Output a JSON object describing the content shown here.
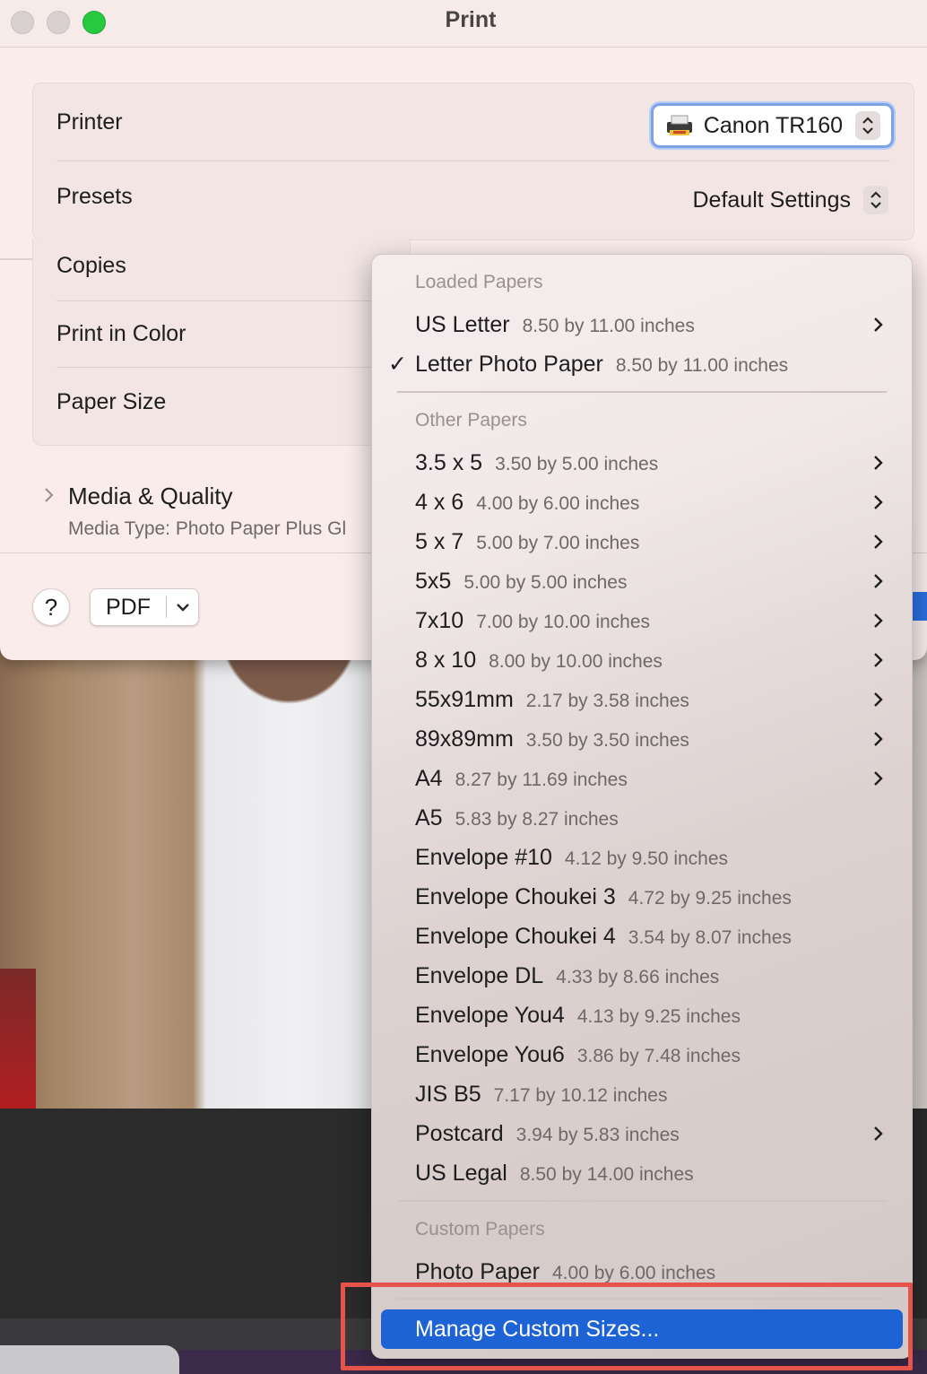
{
  "window": {
    "title": "Print"
  },
  "printer": {
    "label": "Printer",
    "value": "Canon TR160"
  },
  "presets": {
    "label": "Presets",
    "value": "Default Settings"
  },
  "settings": {
    "copies_label": "Copies",
    "color_label": "Print in Color",
    "paper_size_label": "Paper Size"
  },
  "media_quality": {
    "title": "Media & Quality",
    "subtitle": "Media Type: Photo Paper Plus Gl"
  },
  "footer": {
    "help_label": "?",
    "pdf_label": "PDF"
  },
  "menu": {
    "loaded_header": "Loaded Papers",
    "loaded": [
      {
        "name": "US Letter",
        "desc": "8.50 by 11.00 inches"
      },
      {
        "name": "Letter Photo Paper",
        "desc": "8.50 by 11.00 inches"
      }
    ],
    "other_header": "Other Papers",
    "other": [
      {
        "name": "3.5 x 5",
        "desc": "3.50 by 5.00 inches"
      },
      {
        "name": "4 x 6",
        "desc": "4.00 by 6.00 inches"
      },
      {
        "name": "5 x 7",
        "desc": "5.00 by 7.00 inches"
      },
      {
        "name": "5x5",
        "desc": "5.00 by 5.00 inches"
      },
      {
        "name": "7x10",
        "desc": "7.00 by 10.00 inches"
      },
      {
        "name": "8 x 10",
        "desc": "8.00 by 10.00 inches"
      },
      {
        "name": "55x91mm",
        "desc": "2.17 by 3.58 inches"
      },
      {
        "name": "89x89mm",
        "desc": "3.50 by 3.50 inches"
      },
      {
        "name": "A4",
        "desc": "8.27 by 11.69 inches"
      },
      {
        "name": "A5",
        "desc": "5.83 by 8.27 inches"
      },
      {
        "name": "Envelope #10",
        "desc": "4.12 by 9.50 inches"
      },
      {
        "name": "Envelope Choukei 3",
        "desc": "4.72 by 9.25 inches"
      },
      {
        "name": "Envelope Choukei 4",
        "desc": "3.54 by 8.07 inches"
      },
      {
        "name": "Envelope DL",
        "desc": "4.33 by 8.66 inches"
      },
      {
        "name": "Envelope You4",
        "desc": "4.13 by 9.25 inches"
      },
      {
        "name": "Envelope You6",
        "desc": "3.86 by 7.48 inches"
      },
      {
        "name": "JIS B5",
        "desc": "7.17 by 10.12 inches"
      },
      {
        "name": "Postcard",
        "desc": "3.94 by 5.83 inches"
      },
      {
        "name": "US Legal",
        "desc": "8.50 by 14.00 inches"
      }
    ],
    "custom_header": "Custom Papers",
    "custom": [
      {
        "name": "Photo Paper",
        "desc": "4.00 by 6.00 inches"
      }
    ],
    "manage_label": "Manage Custom Sizes...",
    "checkmark": "✓"
  },
  "colors": {
    "accent": "#1e63d6",
    "highlight_box": "#e5534b",
    "zoom_button": "#27c93f"
  },
  "icons": {
    "printer": "printer-icon",
    "stepper": "up-down-chevron-icon",
    "submenu": "chevron-right-icon",
    "disclosure": "chevron-right-icon",
    "pdf_menu": "chevron-down-icon"
  }
}
